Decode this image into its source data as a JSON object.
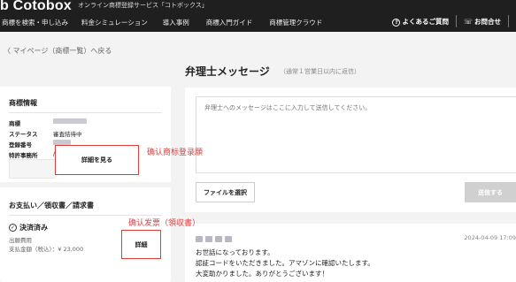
{
  "header": {
    "logo": "b Cotobox",
    "tagline": "オンライン商標登録サービス「コトボックス」",
    "nav": [
      "商標を検索・申し込み",
      "料金シミュレーション",
      "導入事例",
      "商標入門ガイド",
      "商標管理クラウド"
    ],
    "faq": "よくあるご質問",
    "contact": "お問合せ"
  },
  "back_link": "〈 マイページ（商標一覧）へ戻る",
  "trademark_card": {
    "title": "商標情報",
    "rows": [
      {
        "label": "商標",
        "value": ""
      },
      {
        "label": "ステータス",
        "value": "審査結待中"
      },
      {
        "label": "登録番号",
        "value": ""
      },
      {
        "label": "特許事務所",
        "value": "/"
      }
    ],
    "detail_button": "詳細を見る"
  },
  "payment_card": {
    "title": "お支払い／領収書／請求書",
    "status": "決済済み",
    "item": "出願費用",
    "amount": "支払金額（税込）：¥ 23,000",
    "detail_button": "詳細"
  },
  "annotations": {
    "confirm_trademark": "确认商标登录願",
    "confirm_invoice": "确认发票（領収書）"
  },
  "message_panel": {
    "title": "弁理士メッセージ",
    "subtitle": "（通常１営業日以内に返信）",
    "placeholder": "弁理士へのメッセージはここに入力して送信してください。",
    "file_button": "ファイルを選択",
    "send_button": "送信する"
  },
  "message": {
    "date": "2024-04-09 17:09",
    "lines": [
      "お世話になっております。",
      "認証コードをいただきました。アマゾンに確認いたします。",
      "大変助かりました。ありがとうございます！"
    ]
  },
  "colors": {
    "header_bg": "#1f1f1f",
    "highlight_red": "#e23d3d",
    "page_bg": "#f3f3f3"
  }
}
